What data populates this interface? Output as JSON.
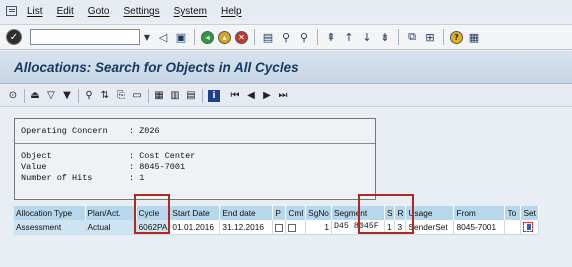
{
  "menu": [
    "List",
    "Edit",
    "Goto",
    "Settings",
    "System",
    "Help"
  ],
  "toolbar": {
    "command_field_value": "",
    "ok_icon": "enter-icon",
    "icons": [
      "back-icon",
      "save-icon",
      "back-green-icon",
      "exit-icon",
      "cancel-icon",
      "print-icon",
      "find-icon",
      "find-next-icon",
      "first-page-icon",
      "prev-page-icon",
      "next-page-icon",
      "last-page-icon",
      "new-session-icon",
      "shortcut-icon",
      "help-icon",
      "layout-icon"
    ]
  },
  "title": "Allocations: Search for Objects in All Cycles",
  "app_toolbar_icons": [
    "details-icon",
    "print-list-icon",
    "filter-icon",
    "filter-set-icon",
    "find-icon",
    "sort-icon",
    "export-icon",
    "layout-icon",
    "grid-icon",
    "columns-icon",
    "table-icon",
    "info-icon",
    "first-icon",
    "previous-icon",
    "next-icon",
    "last-icon"
  ],
  "info": {
    "operating_concern_label": "Operating Concern",
    "operating_concern_value": ": Z026",
    "object_label": "Object",
    "object_value": ": Cost Center",
    "value_label": "Value",
    "value_value": ": 8045-7001",
    "hits_label": "Number of Hits",
    "hits_value": ": 1"
  },
  "table": {
    "headers": [
      "Allocation Type",
      "Plan/Act.",
      "Cycle",
      "Start Date",
      "End date",
      "P",
      "Cml",
      "SgNo",
      "Segment",
      "S",
      "R",
      "Usage",
      "From",
      "To",
      "Set"
    ],
    "rows": [
      {
        "allocation_type": "Assessment",
        "plan_act": "Actual",
        "cycle": "6062PA",
        "start_date": "01.01.2016",
        "end_date": "31.12.2016",
        "sgno": "1",
        "segment": "D45",
        "segment_code": "8045F",
        "s": "1",
        "r": "3",
        "usage": "SenderSet",
        "from": "8045-7001",
        "to": ""
      }
    ]
  },
  "colors": {
    "header_bg": "#b7d8ec",
    "highlight_box": "#b02a22",
    "title_text": "#163a63"
  }
}
